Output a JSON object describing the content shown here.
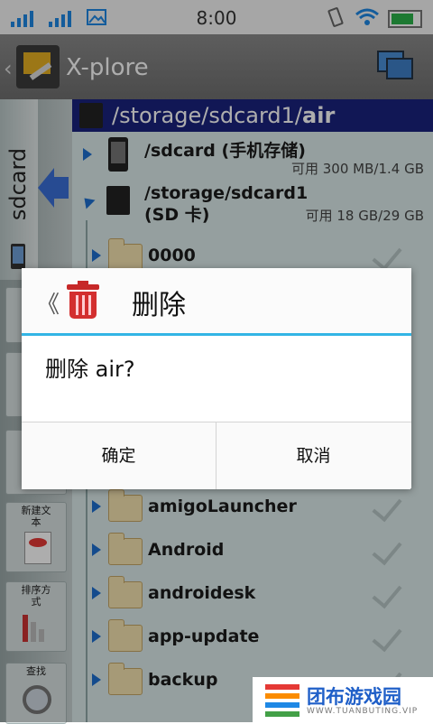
{
  "status_bar": {
    "time": "8:00"
  },
  "app": {
    "title": "X-plore"
  },
  "left_panel": {
    "tab_label": "sdcard",
    "buttons": [
      {
        "label": "新建文本"
      },
      {
        "label": "排序方式"
      },
      {
        "label": "查找"
      }
    ]
  },
  "file_list": {
    "path": {
      "prefix": "/storage/sdcard1/",
      "current": "air"
    },
    "volumes": [
      {
        "name": "/sdcard (手机存储)",
        "info": "可用 300 MB/1.4 GB"
      },
      {
        "name": "/storage/sdcard1 (SD 卡)",
        "info": "可用 18 GB/29 GB"
      }
    ],
    "folders": [
      "0000",
      "amigoLauncher",
      "Android",
      "androidesk",
      "app-update",
      "backup"
    ]
  },
  "dialog": {
    "back": "《",
    "title": "删除",
    "message": "删除 air?",
    "ok_label": "确定",
    "cancel_label": "取消"
  },
  "watermark": {
    "text": "团布游戏园",
    "subtext": "WWW.TUANBUTING.VIP"
  },
  "colors": {
    "accent": "#33b5e5",
    "path_bar": "#1a237e",
    "arrow": "#1e6fd0"
  }
}
